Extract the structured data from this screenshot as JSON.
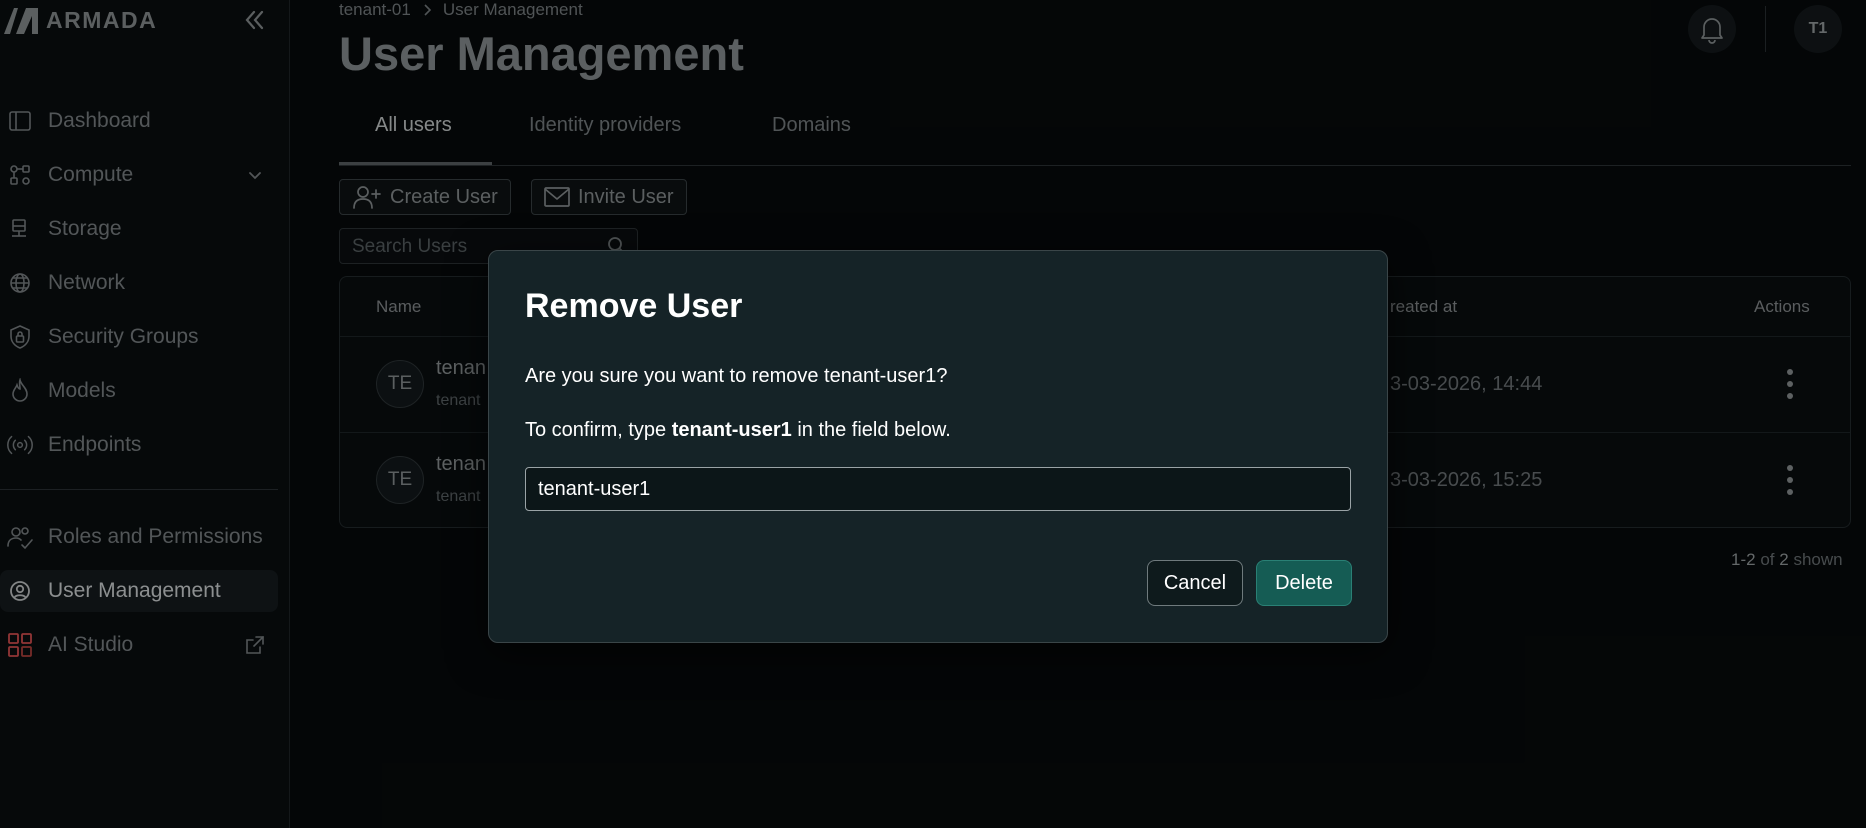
{
  "app": {
    "logo_text": "ARMADA"
  },
  "sidebar": {
    "items": [
      {
        "label": "Dashboard",
        "icon": "dashboard-icon"
      },
      {
        "label": "Compute",
        "icon": "compute-icon"
      },
      {
        "label": "Storage",
        "icon": "storage-icon"
      },
      {
        "label": "Network",
        "icon": "globe-icon"
      },
      {
        "label": "Security Groups",
        "icon": "shield-lock-icon"
      },
      {
        "label": "Models",
        "icon": "flame-icon"
      },
      {
        "label": "Endpoints",
        "icon": "broadcast-icon"
      },
      {
        "label": "Roles and Permissions",
        "icon": "users-check-icon"
      },
      {
        "label": "User Management",
        "icon": "user-circle-icon"
      },
      {
        "label": "AI Studio",
        "icon": "grid-apps-icon"
      }
    ],
    "active": "User Management"
  },
  "header": {
    "breadcrumb": [
      "tenant-01",
      "User Management"
    ],
    "title": "User Management",
    "avatar_initials": "T1"
  },
  "tabs": [
    {
      "label": "All users",
      "active": true
    },
    {
      "label": "Identity providers",
      "active": false
    },
    {
      "label": "Domains",
      "active": false
    }
  ],
  "toolbar": {
    "create_user_label": "Create User",
    "invite_user_label": "Invite User",
    "search_placeholder": "Search Users"
  },
  "table": {
    "columns": {
      "name": "Name",
      "created_at": "reated at",
      "actions": "Actions"
    },
    "rows": [
      {
        "initials": "TE",
        "name": "tenan",
        "sub": "tenant",
        "created": "3-03-2026, 14:44"
      },
      {
        "initials": "TE",
        "name": "tenan",
        "sub": "tenant",
        "created": "3-03-2026, 15:25"
      }
    ],
    "pager": {
      "range": "1-2",
      "of": "of",
      "total": "2",
      "suffix": "shown"
    }
  },
  "modal": {
    "title": "Remove User",
    "question": "Are you sure you want to remove tenant-user1?",
    "confirm_prefix": "To confirm, type",
    "confirm_name": "tenant-user1",
    "confirm_suffix": "in the field below.",
    "input_value": "tenant-user1",
    "cancel_label": "Cancel",
    "delete_label": "Delete"
  },
  "colors": {
    "accent": "#155c54",
    "modal_bg": "#152327",
    "page_bg": "#070a0b"
  }
}
